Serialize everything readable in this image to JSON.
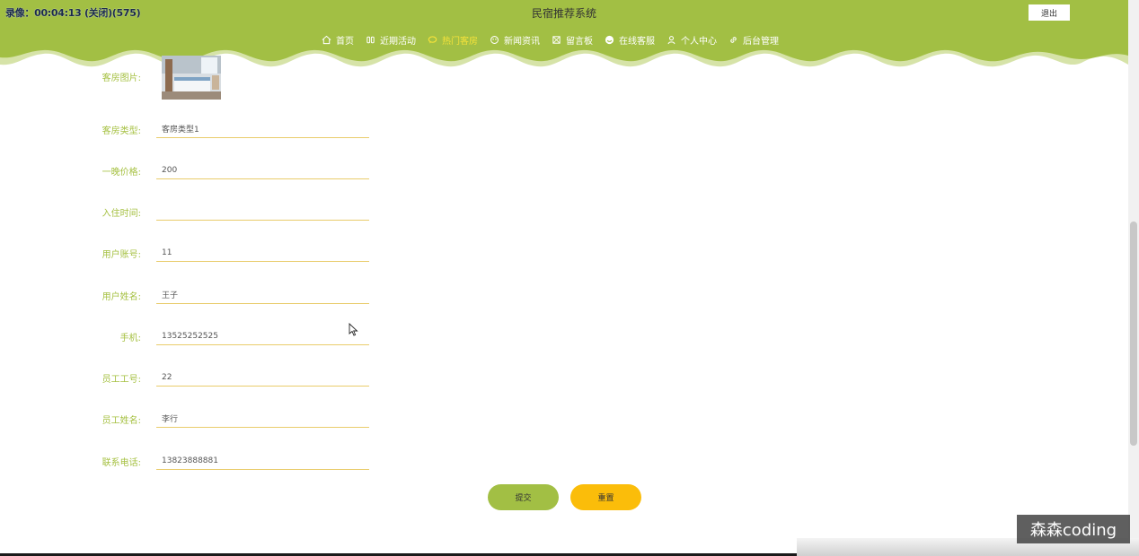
{
  "recording": "录像：00:04:13 (关闭)(575)",
  "header": {
    "title": "民宿推荐系统",
    "logout_label": "退出",
    "nav": [
      {
        "label": "首页",
        "icon": "home-icon",
        "active": false
      },
      {
        "label": "近期活动",
        "icon": "activity-icon",
        "active": false
      },
      {
        "label": "热门客房",
        "icon": "chat-icon",
        "active": true
      },
      {
        "label": "新闻资讯",
        "icon": "news-icon",
        "active": false
      },
      {
        "label": "留言板",
        "icon": "message-board-icon",
        "active": false
      },
      {
        "label": "在线客服",
        "icon": "support-icon",
        "active": false
      },
      {
        "label": "个人中心",
        "icon": "user-icon",
        "active": false
      },
      {
        "label": "后台管理",
        "icon": "link-icon",
        "active": false
      }
    ]
  },
  "form": {
    "image_label": "客房图片:",
    "fields": [
      {
        "label": "客房类型:",
        "value": "客房类型1"
      },
      {
        "label": "一晚价格:",
        "value": "200"
      },
      {
        "label": "入住时间:",
        "value": ""
      },
      {
        "label": "用户账号:",
        "value": "11"
      },
      {
        "label": "用户姓名:",
        "value": "王子"
      },
      {
        "label": "手机:",
        "value": "13525252525"
      },
      {
        "label": "员工工号:",
        "value": "22"
      },
      {
        "label": "员工姓名:",
        "value": "李行"
      },
      {
        "label": "联系电话:",
        "value": "13823888881"
      }
    ],
    "submit_label": "提交",
    "reset_label": "重置"
  },
  "watermark": "森森coding",
  "colors": {
    "header_green": "#a2bf44",
    "label_green": "#a5c041",
    "underline_yellow": "#e9cc6b",
    "active_nav_yellow": "#f5e23a",
    "reset_yellow": "#fbbd0a"
  }
}
